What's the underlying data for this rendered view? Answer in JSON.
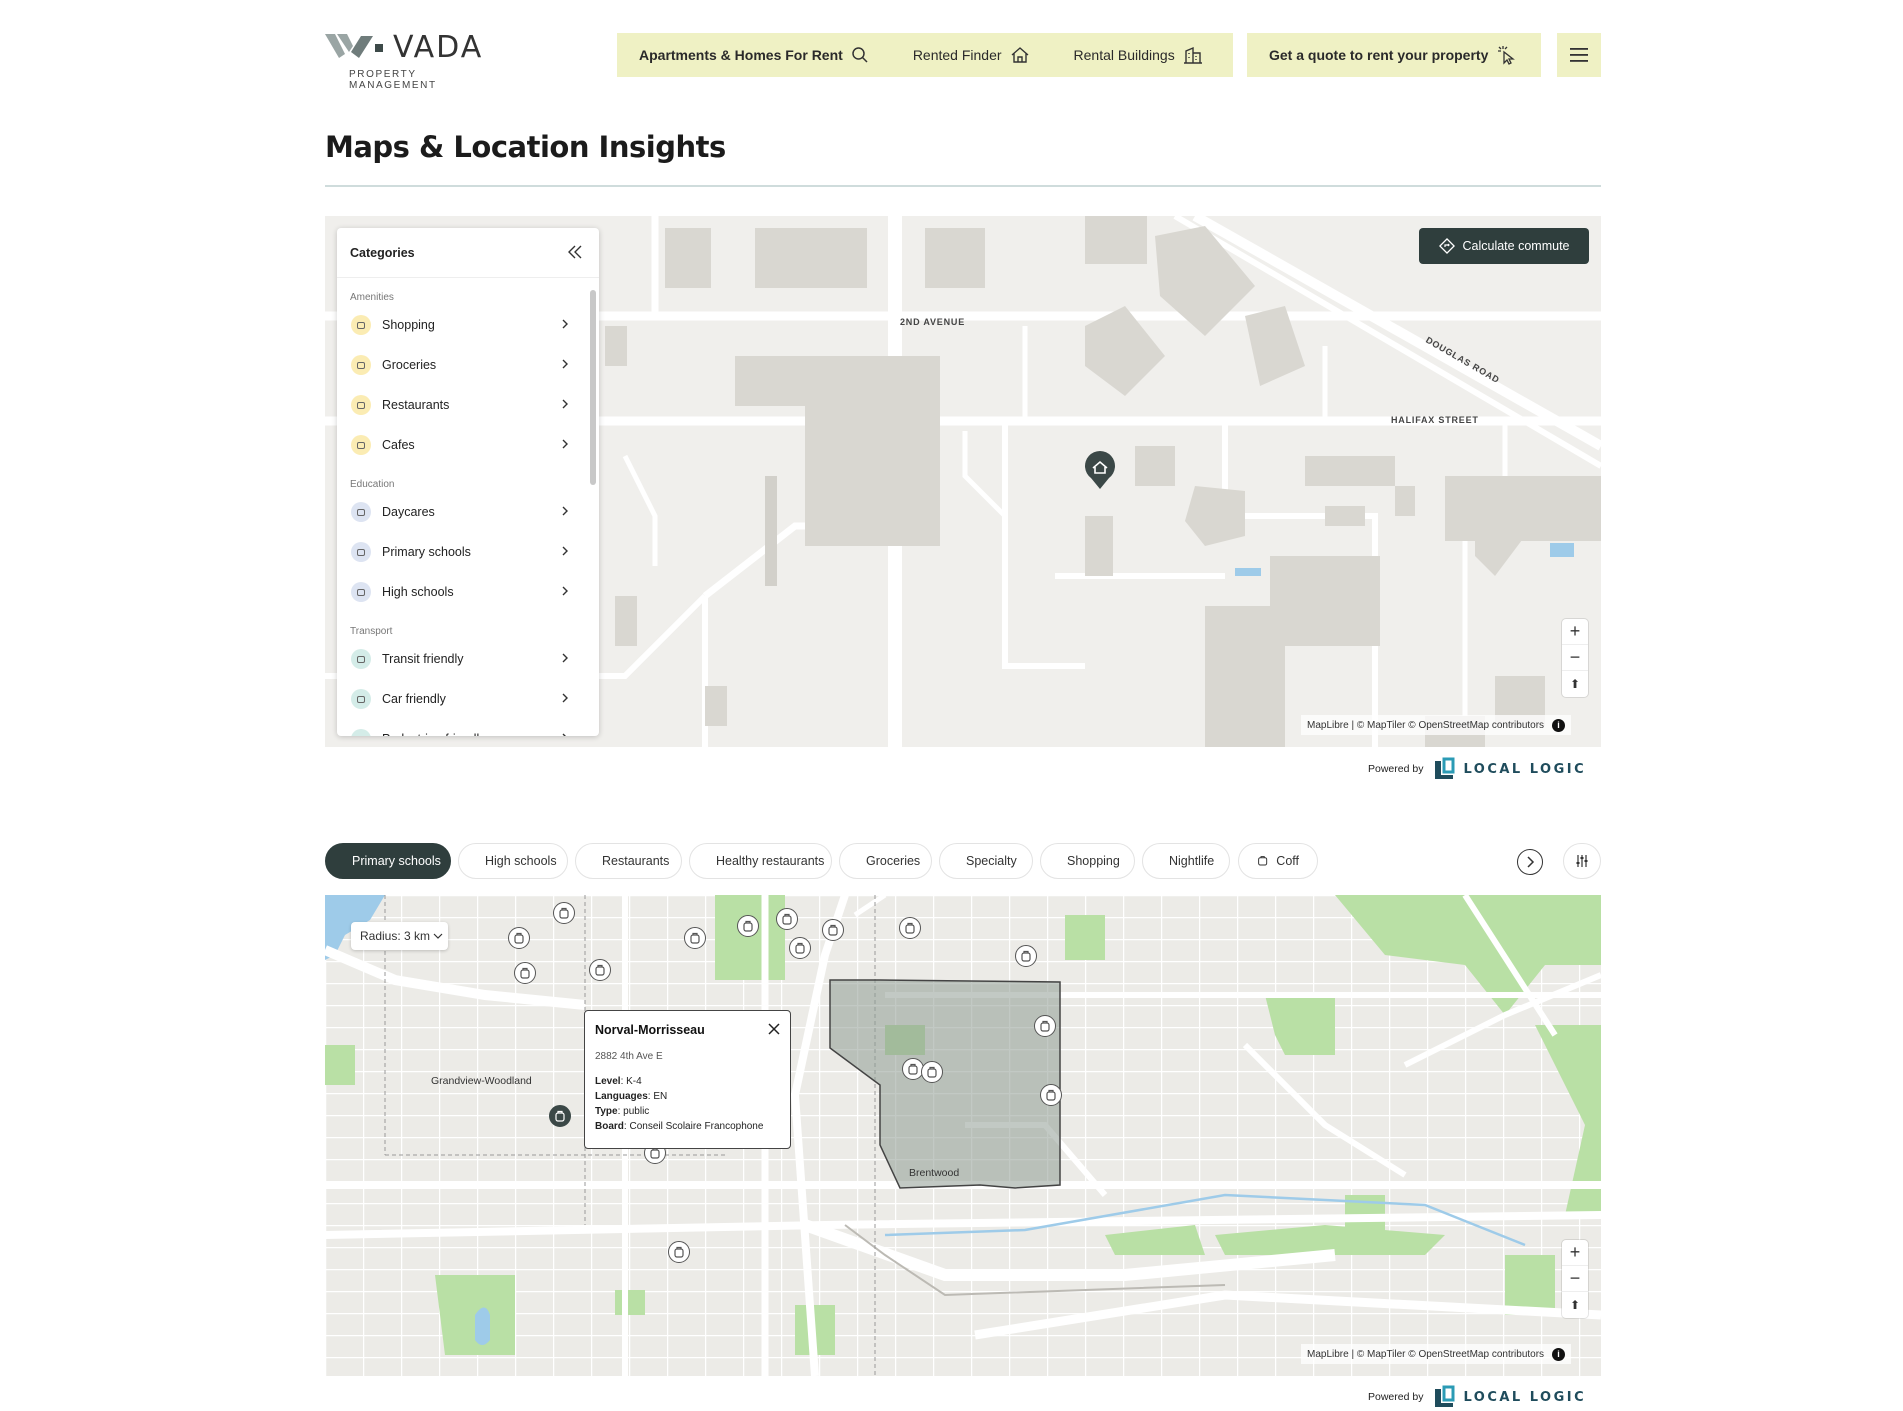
{
  "header": {
    "logo": {
      "brand": "VADA",
      "sub": "PROPERTY MANAGEMENT"
    },
    "nav": [
      {
        "label": "Apartments & Homes For Rent",
        "icon": "search-icon"
      },
      {
        "label": "Rented Finder",
        "icon": "home-icon"
      },
      {
        "label": "Rental Buildings",
        "icon": "building-icon"
      }
    ],
    "quote_label": "Get a quote to rent your property",
    "quote_icon": "cursor-click-icon",
    "menu_icon": "hamburger-menu-icon"
  },
  "page_title": "Maps & Location Insights",
  "map1": {
    "panel_title": "Categories",
    "groups": [
      {
        "label": "Amenities",
        "items": [
          {
            "label": "Shopping",
            "icon": "shopping-bag-icon"
          },
          {
            "label": "Groceries",
            "icon": "store-icon"
          },
          {
            "label": "Restaurants",
            "icon": "fork-knife-icon"
          },
          {
            "label": "Cafes",
            "icon": "coffee-cup-icon"
          }
        ]
      },
      {
        "label": "Education",
        "items": [
          {
            "label": "Daycares",
            "icon": "daycare-icon"
          },
          {
            "label": "Primary schools",
            "icon": "backpack-icon"
          },
          {
            "label": "High schools",
            "icon": "graduation-cap-icon"
          }
        ]
      },
      {
        "label": "Transport",
        "items": [
          {
            "label": "Transit friendly",
            "icon": "bus-icon"
          },
          {
            "label": "Car friendly",
            "icon": "car-icon"
          },
          {
            "label": "Pedestrian friendly",
            "icon": "walking-icon"
          }
        ]
      }
    ],
    "calculate_label": "Calculate commute",
    "streets": [
      "2ND AVENUE",
      "DOUGLAS ROAD",
      "HALIFAX STREET"
    ],
    "attribution": "MapLibre | © MapTiler © OpenStreetMap contributors",
    "powered_by": "Powered by",
    "brand": "LOCAL LOGIC"
  },
  "chips": [
    {
      "label": "Primary schools",
      "icon": "backpack-icon",
      "active": true
    },
    {
      "label": "High schools",
      "icon": "graduation-cap-icon"
    },
    {
      "label": "Restaurants",
      "icon": "fork-knife-icon"
    },
    {
      "label": "Healthy restaurants",
      "icon": "fork-knife-icon"
    },
    {
      "label": "Groceries",
      "icon": "store-icon"
    },
    {
      "label": "Specialty",
      "icon": "store-icon"
    },
    {
      "label": "Shopping",
      "icon": "cart-icon"
    },
    {
      "label": "Nightlife",
      "icon": "cocktail-icon"
    },
    {
      "label": "Coff",
      "icon": "coffee-cup-icon"
    }
  ],
  "map2": {
    "radius_label": "Radius: 3 km",
    "popup": {
      "title": "Norval-Morrisseau",
      "address": "2882 4th Ave E",
      "level_key": "Level",
      "level": "K-4",
      "languages_key": "Languages",
      "languages": "EN",
      "type_key": "Type",
      "type": "public",
      "board_key": "Board",
      "board": "Conseil Scolaire Francophone"
    },
    "places": [
      "Grandview-Woodland",
      "Brentwood"
    ],
    "attribution": "MapLibre | © MapTiler © OpenStreetMap contributors",
    "powered_by": "Powered by",
    "brand": "LOCAL LOGIC"
  },
  "colors": {
    "accent": "#eff1c4",
    "dark": "#2f3e3d",
    "brand": "#1f4c5c"
  }
}
